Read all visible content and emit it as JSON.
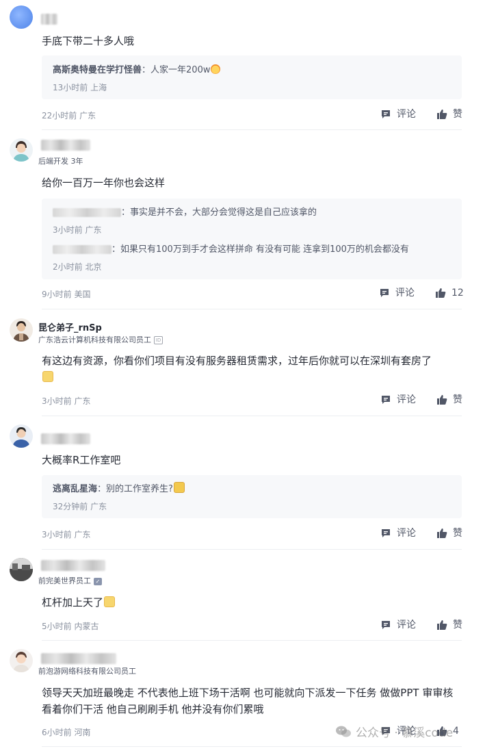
{
  "actions": {
    "reply_label": "评论",
    "like_label": "赞"
  },
  "comments": [
    {
      "content": "手底下带二十多人哦",
      "replies": [
        {
          "user": "高斯奥特曼在学打怪兽",
          "text": "人家一年200w",
          "time": "13小时前 上海"
        }
      ],
      "time": "22小时前 广东",
      "likes": "赞"
    },
    {
      "subtitle": "后端开发 3年",
      "content": "给你一百万一年你也会这样",
      "replies": [
        {
          "user": "",
          "text": "事实是并不会，大部分会觉得这是自己应该拿的",
          "time": "3小时前 广东"
        },
        {
          "user": "",
          "text": "如果只有100万到手才会这样拼命 有没有可能 连拿到100万的机会都没有",
          "time": "2小时前 北京"
        }
      ],
      "time": "9小时前 美国",
      "likes": "12"
    },
    {
      "username": "昆仑弟子_rnSp",
      "subtitle": "广东浩云计算机科技有限公司员工",
      "content": "有这边有资源，你看你们项目有没有服务器租赁需求，过年后你就可以在深圳有套房了",
      "time": "3小时前 广东",
      "likes": "赞"
    },
    {
      "content": "大概率R工作室吧",
      "replies": [
        {
          "user": "逃离乱星海",
          "text": "别的工作室养生?",
          "time": "32分钟前 广东"
        }
      ],
      "time": "3小时前 广东",
      "likes": "赞"
    },
    {
      "subtitle": "前完美世界员工",
      "content": "杠杆加上天了",
      "time": "5小时前 内蒙古",
      "likes": "赞"
    },
    {
      "subtitle": "前泡游网络科技有限公司员工",
      "content": "领导天天加班最晚走 不代表他上班下场干活啊 也可能就向下派发一下任务 做做PPT 审审核 看着你们干活 他自己刷刷手机 他并没有你们累哦",
      "time": "6小时前 河南",
      "likes": "4"
    }
  ],
  "watermark": "公众号 · 慕溪code",
  "colors": {
    "text": "#252933",
    "secondary": "#8a919f",
    "reply_bg": "#f7f8fa"
  }
}
